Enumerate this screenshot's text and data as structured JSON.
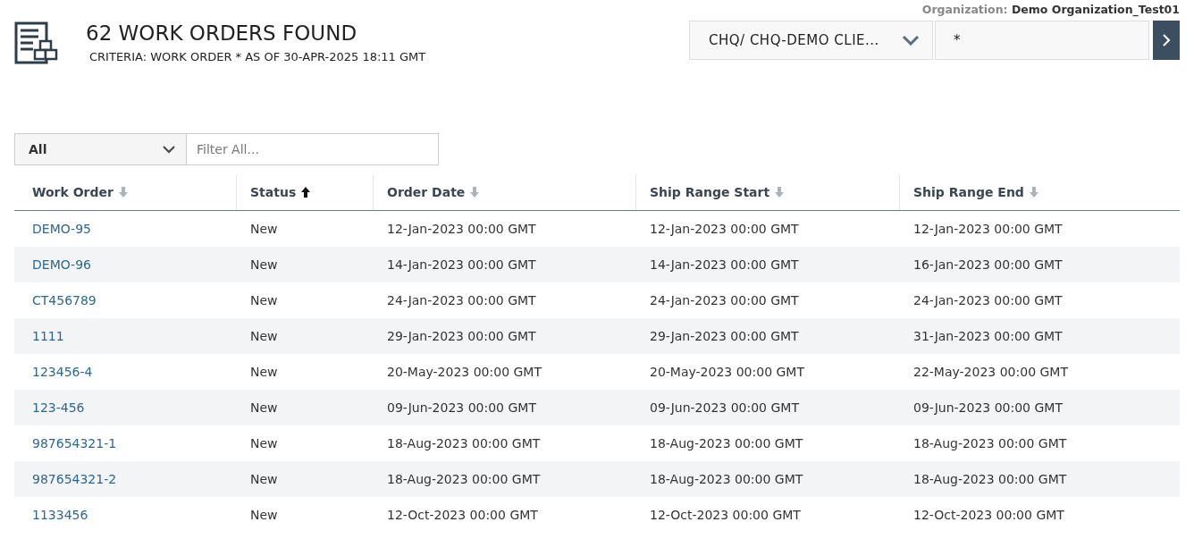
{
  "header": {
    "title": "62 WORK ORDERS FOUND",
    "criteria": "CRITERIA: WORK ORDER * AS OF 30-APR-2025 18:11 GMT",
    "organization_label": "Organization:",
    "organization": "Demo Organization_Test01"
  },
  "search": {
    "client": "CHQ/ CHQ-DEMO CLIE...",
    "query": "*"
  },
  "filter": {
    "scope": "All",
    "placeholder": "Filter All..."
  },
  "table": {
    "columns": [
      {
        "label": "Work Order",
        "sorted": false,
        "ascending": false
      },
      {
        "label": "Status",
        "sorted": true,
        "ascending": true
      },
      {
        "label": "Order Date",
        "sorted": false,
        "ascending": false
      },
      {
        "label": "Ship Range Start",
        "sorted": false,
        "ascending": false
      },
      {
        "label": "Ship Range End",
        "sorted": false,
        "ascending": false
      }
    ],
    "rows": [
      [
        "DEMO-95",
        "New",
        "12-Jan-2023 00:00 GMT",
        "12-Jan-2023 00:00 GMT",
        "12-Jan-2023 00:00 GMT"
      ],
      [
        "DEMO-96",
        "New",
        "14-Jan-2023 00:00 GMT",
        "14-Jan-2023 00:00 GMT",
        "16-Jan-2023 00:00 GMT"
      ],
      [
        "CT456789",
        "New",
        "24-Jan-2023 00:00 GMT",
        "24-Jan-2023 00:00 GMT",
        "24-Jan-2023 00:00 GMT"
      ],
      [
        "1111",
        "New",
        "29-Jan-2023 00:00 GMT",
        "29-Jan-2023 00:00 GMT",
        "31-Jan-2023 00:00 GMT"
      ],
      [
        "123456-4",
        "New",
        "20-May-2023 00:00 GMT",
        "20-May-2023 00:00 GMT",
        "22-May-2023 00:00 GMT"
      ],
      [
        "123-456",
        "New",
        "09-Jun-2023 00:00 GMT",
        "09-Jun-2023 00:00 GMT",
        "09-Jun-2023 00:00 GMT"
      ],
      [
        "987654321-1",
        "New",
        "18-Aug-2023 00:00 GMT",
        "18-Aug-2023 00:00 GMT",
        "18-Aug-2023 00:00 GMT"
      ],
      [
        "987654321-2",
        "New",
        "18-Aug-2023 00:00 GMT",
        "18-Aug-2023 00:00 GMT",
        "18-Aug-2023 00:00 GMT"
      ],
      [
        "1133456",
        "New",
        "12-Oct-2023 00:00 GMT",
        "12-Oct-2023 00:00 GMT",
        "12-Oct-2023 00:00 GMT"
      ]
    ]
  }
}
